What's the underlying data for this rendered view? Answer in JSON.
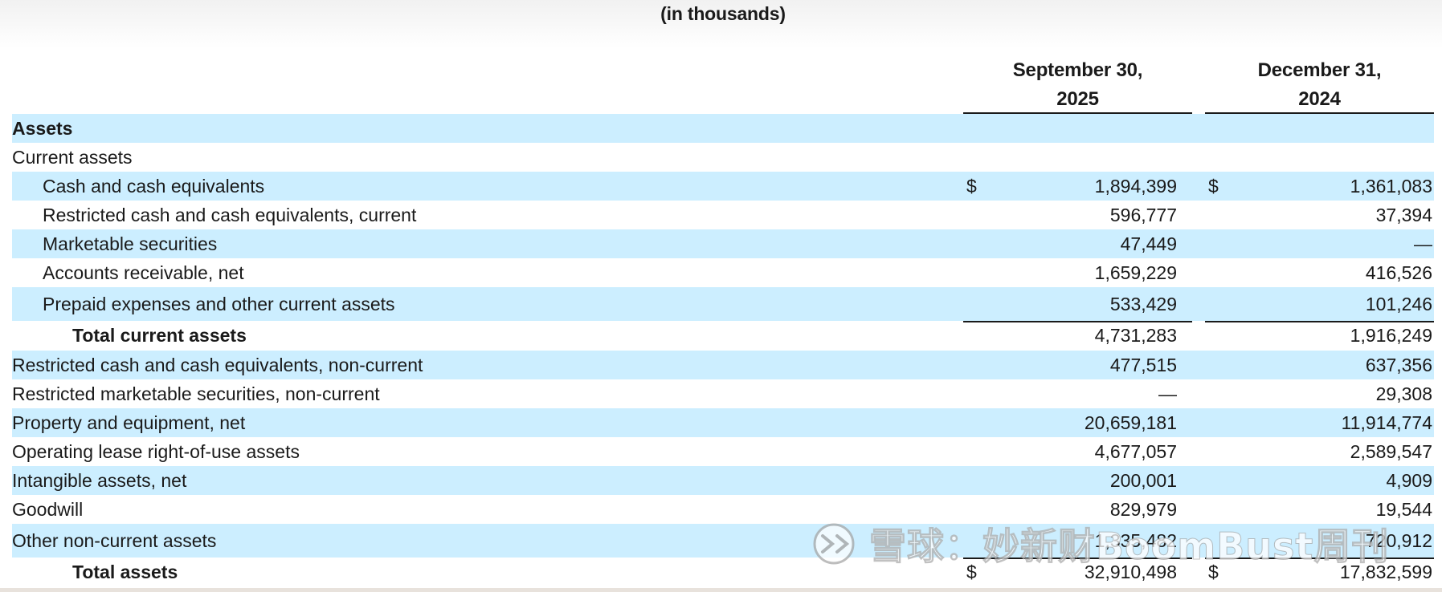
{
  "header": {
    "subtitle": "(in thousands)",
    "columns": [
      {
        "line1": "September 30,",
        "line2": "2025"
      },
      {
        "line1": "December 31,",
        "line2": "2024"
      }
    ]
  },
  "rows": [
    {
      "label": "Assets",
      "c1": "",
      "c2": ""
    },
    {
      "label": "Current assets",
      "c1": "",
      "c2": ""
    },
    {
      "label": "Cash and cash equivalents",
      "cur1": "$",
      "c1": "1,894,399",
      "cur2": "$",
      "c2": "1,361,083"
    },
    {
      "label": "Restricted cash and cash equivalents, current",
      "c1": "596,777",
      "c2": "37,394"
    },
    {
      "label": "Marketable securities",
      "c1": "47,449",
      "c2": "—"
    },
    {
      "label": "Accounts receivable, net",
      "c1": "1,659,229",
      "c2": "416,526"
    },
    {
      "label": "Prepaid expenses and other current assets",
      "c1": "533,429",
      "c2": "101,246"
    },
    {
      "label": "Total current assets",
      "c1": "4,731,283",
      "c2": "1,916,249"
    },
    {
      "label": "Restricted cash and cash equivalents, non-current",
      "c1": "477,515",
      "c2": "637,356"
    },
    {
      "label": "Restricted marketable securities, non-current",
      "c1": "—",
      "c2": "29,308"
    },
    {
      "label": "Property and equipment, net",
      "c1": "20,659,181",
      "c2": "11,914,774"
    },
    {
      "label": "Operating lease right-of-use assets",
      "c1": "4,677,057",
      "c2": "2,589,547"
    },
    {
      "label": "Intangible assets, net",
      "c1": "200,001",
      "c2": "4,909"
    },
    {
      "label": "Goodwill",
      "c1": "829,979",
      "c2": "19,544"
    },
    {
      "label": "Other non-current assets",
      "c1": "1,335,482",
      "c2": "720,912"
    },
    {
      "label": "Total assets",
      "cur1": "$",
      "c1": "32,910,498",
      "cur2": "$",
      "c2": "17,832,599"
    }
  ],
  "watermark": {
    "text": "雪球：妙新财BoomBust周刊",
    "icon": "snowball-logo-icon"
  },
  "colors": {
    "row_shade": "#cceeff",
    "text": "#1a1a1a"
  }
}
